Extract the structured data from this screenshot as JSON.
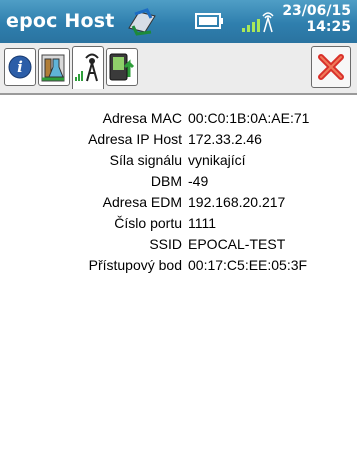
{
  "titlebar": {
    "app_title": "epoc Host",
    "date": "23/06/15",
    "time": "14:25",
    "icons": [
      "sync-icon",
      "battery-icon",
      "signal-strength-icon"
    ]
  },
  "tabs": [
    {
      "name": "info-tab",
      "icon": "info-icon",
      "active": false
    },
    {
      "name": "test-tab",
      "icon": "lab-flask-icon",
      "active": false
    },
    {
      "name": "wireless-tab",
      "icon": "wireless-antenna-icon",
      "active": true
    },
    {
      "name": "sync-tab",
      "icon": "device-upload-icon",
      "active": false
    }
  ],
  "close_icon": "close-x-icon",
  "info_rows": [
    {
      "label": "Adresa MAC",
      "value": "00:C0:1B:0A:AE:71"
    },
    {
      "label": "Adresa IP Host",
      "value": "172.33.2.46"
    },
    {
      "label": "Síla signálu",
      "value": "vynikající"
    },
    {
      "label": "DBM",
      "value": "-49"
    },
    {
      "label": "Adresa EDM",
      "value": "192.168.20.217"
    },
    {
      "label": "Číslo portu",
      "value": "1111"
    },
    {
      "label": "SSID",
      "value": "EPOCAL-TEST"
    },
    {
      "label": "Přístupový bod",
      "value": "00:17:C5:EE:05:3F"
    }
  ],
  "colors": {
    "titlebar": "#2f7fae",
    "close": "#d9302a",
    "accent_green": "#2e9e3a"
  }
}
